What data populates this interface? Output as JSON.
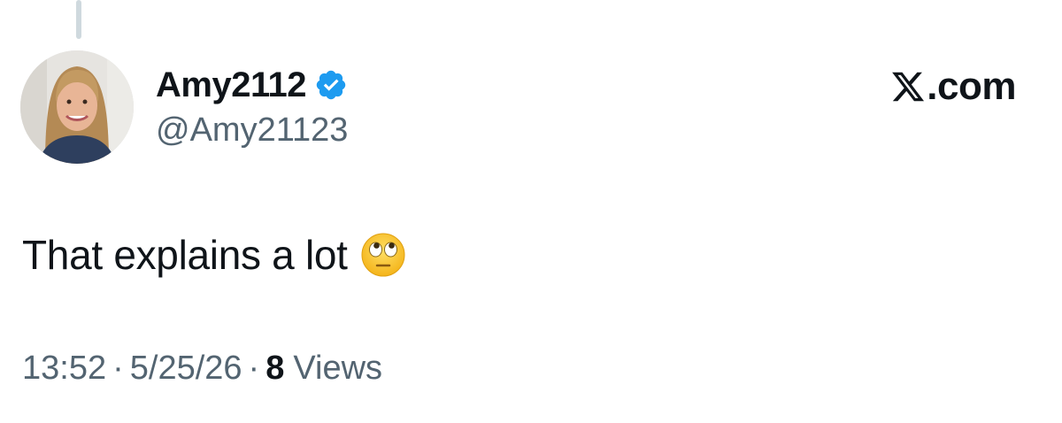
{
  "author": {
    "display_name": "Amy2112",
    "handle": "@Amy21123",
    "verified": true,
    "avatar_icon": "avatar-photo"
  },
  "brand": {
    "logo_icon": "x-logo-icon",
    "domain": ".com"
  },
  "tweet": {
    "text": "That explains a lot",
    "emoji": "face-with-rolling-eyes"
  },
  "meta": {
    "time": "13:52",
    "date": "5/25/26",
    "separator": "·",
    "views_count": "8",
    "views_label": "Views"
  },
  "colors": {
    "text": "#0f1419",
    "secondary": "#536471",
    "verified_badge": "#1d9bf0",
    "thread_line": "#cfd9de"
  }
}
